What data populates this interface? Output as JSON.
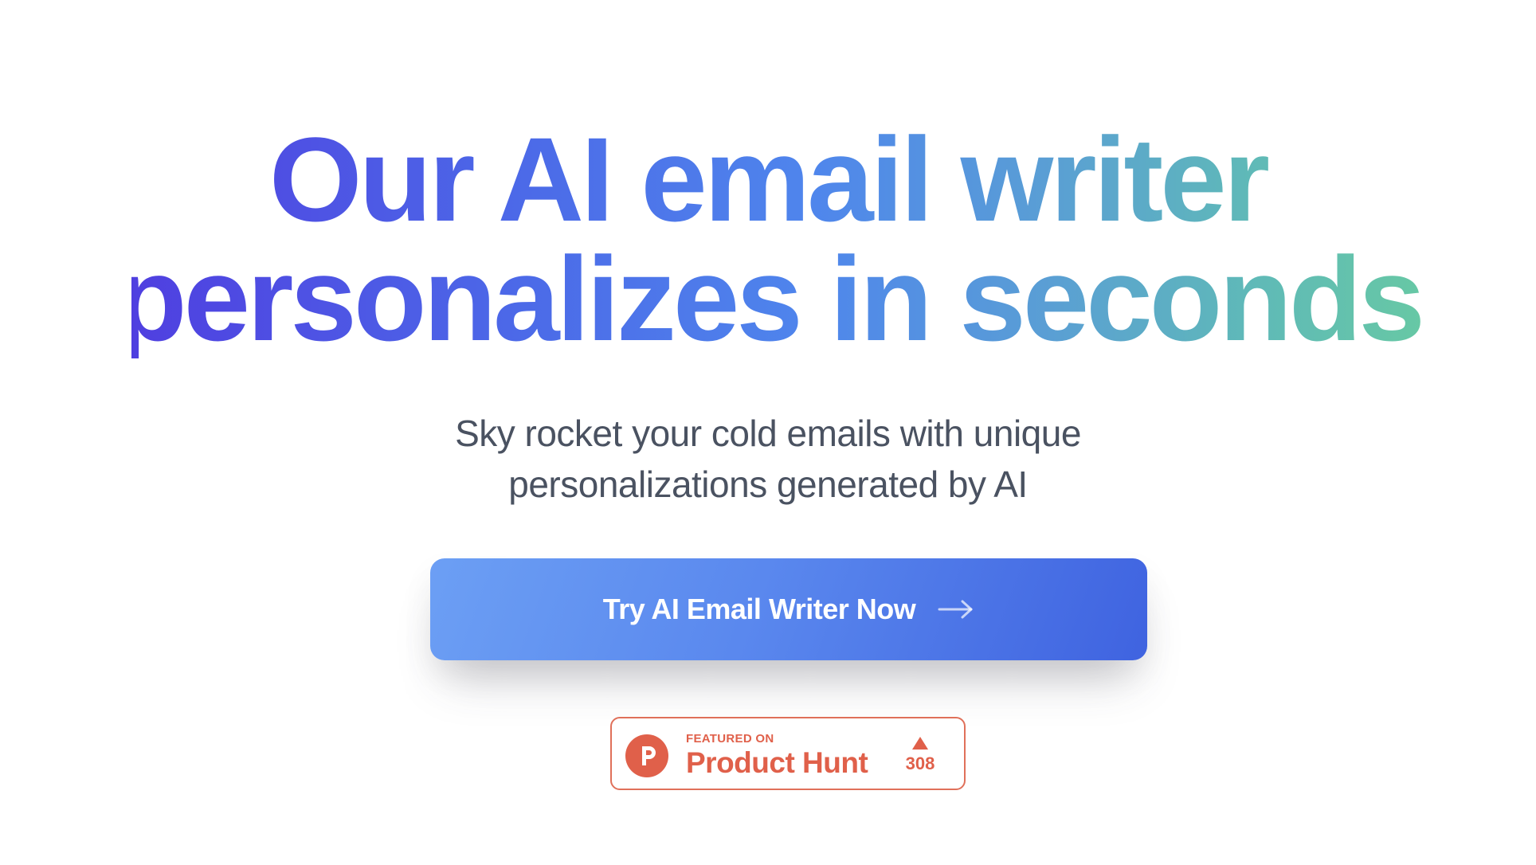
{
  "hero": {
    "title_line_1": "Our AI email writer",
    "title_line_2": "personalizes in seconds",
    "subtitle_line_1": "Sky rocket your cold emails with unique",
    "subtitle_line_2": "personalizations generated by AI"
  },
  "cta": {
    "label": "Try AI Email Writer Now",
    "icon": "arrow-right-icon"
  },
  "product_hunt": {
    "featured_label": "FEATURED ON",
    "name": "Product Hunt",
    "votes": "308",
    "logo_letter": "P",
    "icon": "product-hunt-logo-icon",
    "upvote_icon": "upvote-triangle-icon"
  },
  "colors": {
    "title_gradient_start": "#4f3fe0",
    "title_gradient_mid": "#4f86ec",
    "title_gradient_end": "#68caa2",
    "subtitle": "#4a5261",
    "cta_gradient_start": "#6c9ff4",
    "cta_gradient_end": "#3f63e0",
    "product_hunt_accent": "#e0604a"
  }
}
